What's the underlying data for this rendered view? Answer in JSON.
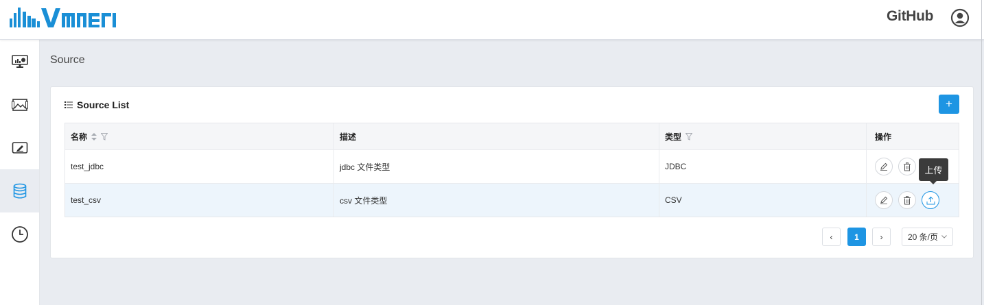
{
  "header": {
    "logo_text": "davinci",
    "github_label": "GitHub"
  },
  "sidebar": {
    "items": [
      {
        "name": "dashboard"
      },
      {
        "name": "widgets"
      },
      {
        "name": "bizlogic"
      },
      {
        "name": "source",
        "active": true
      },
      {
        "name": "schedule"
      }
    ]
  },
  "page": {
    "title": "Source"
  },
  "card": {
    "title": "Source List",
    "add_label": "+"
  },
  "table": {
    "columns": [
      "名称",
      "描述",
      "类型",
      "操作"
    ],
    "rows": [
      {
        "name": "test_jdbc",
        "description": "jdbc 文件类型",
        "type": "JDBC"
      },
      {
        "name": "test_csv",
        "description": "csv 文件类型",
        "type": "CSV"
      }
    ]
  },
  "tooltip": {
    "text": "上传"
  },
  "pagination": {
    "current_page": "1",
    "prev": "‹",
    "next": "›",
    "page_size": "20 条/页"
  },
  "colors": {
    "primary": "#1e95e3",
    "background": "#e9ecf1"
  }
}
